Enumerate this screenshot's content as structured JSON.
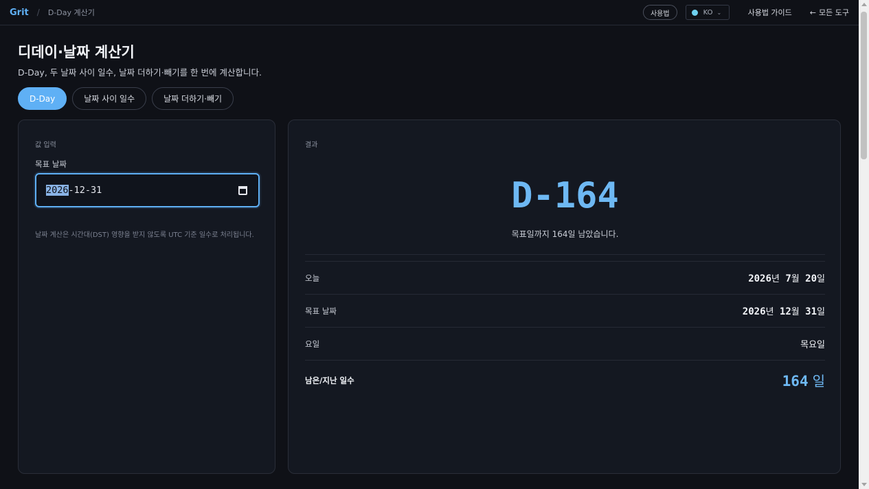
{
  "header": {
    "brand": "Grit",
    "separator": "/",
    "breadcrumb": "D-Day 계산기",
    "usage_button": "사용법",
    "language": "KO",
    "guide_link": "사용법 가이드",
    "all_tools_link": "모든 도구"
  },
  "page": {
    "title": "디데이·날짜 계산기",
    "subtitle": "D-Day, 두 날짜 사이 일수, 날짜 더하기·빼기를 한 번에 계산합니다."
  },
  "tabs": [
    {
      "label": "D-Day",
      "active": true
    },
    {
      "label": "날짜 사이 일수",
      "active": false
    },
    {
      "label": "날짜 더하기·빼기",
      "active": false
    }
  ],
  "input_card": {
    "label": "값 입력",
    "field_label": "목표 날짜",
    "date_year": "2026",
    "date_rest": "-12-31",
    "note": "날짜 계산은 시간대(DST) 영향을 받지 않도록 UTC 기준 일수로 처리됩니다."
  },
  "result_card": {
    "label": "결과",
    "big_value": "D-164",
    "big_desc": "목표일까지 164일 남았습니다.",
    "rows": [
      {
        "label": "오늘",
        "y": "2026",
        "m": "7",
        "d": "20"
      },
      {
        "label": "목표 날짜",
        "y": "2026",
        "m": "12",
        "d": "31"
      }
    ],
    "weekday_label": "요일",
    "weekday_value": "목요일",
    "total_label": "남은/지난 일수",
    "total_value": "164",
    "total_unit": "일",
    "unit_year": "년",
    "unit_month": "월",
    "unit_day": "일"
  },
  "colors": {
    "accent": "#5fb0f5",
    "background": "#0f1117",
    "card": "#141821"
  }
}
